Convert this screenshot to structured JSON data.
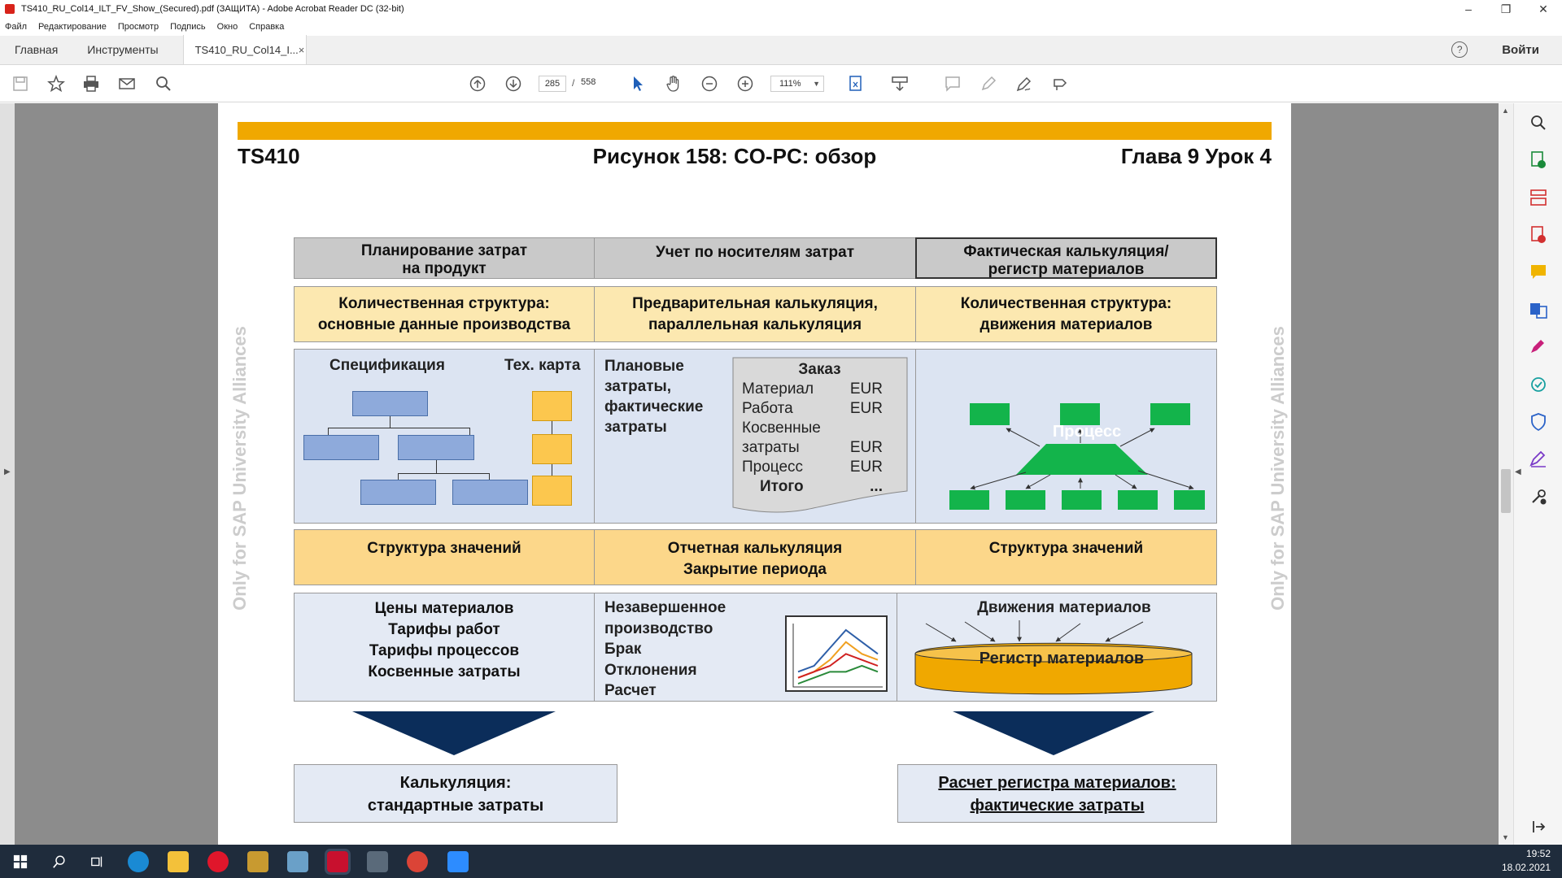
{
  "window": {
    "title": "TS410_RU_Col14_ILT_FV_Show_(Secured).pdf (ЗАЩИТА) - Adobe Acrobat Reader DC (32-bit)",
    "minimize": "–",
    "restore": "❐",
    "close": "✕"
  },
  "menu": [
    "Файл",
    "Редактирование",
    "Просмотр",
    "Подпись",
    "Окно",
    "Справка"
  ],
  "tabs": {
    "home": "Главная",
    "tools": "Инструменты",
    "document": "TS410_RU_Col14_I...",
    "document_close": "×"
  },
  "account": {
    "help": "?",
    "signin": "Войти"
  },
  "toolbar": {
    "page_current": "285",
    "page_sep": "/",
    "page_total": "558",
    "zoom": "111%"
  },
  "slide": {
    "left_header": "TS410",
    "title": "Рисунок 158: CO-PC: обзор",
    "right_header": "Глава 9 Урок 4",
    "watermark": "Only for SAP University Alliances",
    "col_headers": [
      [
        "Планирование затрат",
        "на продукт"
      ],
      [
        "Учет по носителям затрат"
      ],
      [
        "Фактическая калькуляция/",
        "регистр материалов"
      ]
    ],
    "row1": [
      [
        "Количественная структура:",
        "основные данные производства"
      ],
      [
        "Предварительная калькуляция,",
        "параллельная калькуляция"
      ],
      [
        "Количественная структура:",
        "движения материалов"
      ]
    ],
    "bom_label": "Спецификация",
    "routing_label": "Тех. карта",
    "planned_costs": [
      "Плановые",
      "затраты,",
      "фактические",
      "затраты"
    ],
    "order": {
      "title": "Заказ",
      "lines": [
        [
          "Материал",
          "EUR"
        ],
        [
          "Работа",
          "EUR"
        ],
        [
          "Косвенные",
          ""
        ],
        [
          "затраты",
          "EUR"
        ],
        [
          "Процесс",
          "EUR"
        ]
      ],
      "total_label": "Итого",
      "total_value": "..."
    },
    "process_label": "Процесс",
    "row3": [
      [
        "Структура значений"
      ],
      [
        "Отчетная калькуляция",
        "Закрытие периода"
      ],
      [
        "Структура значений"
      ]
    ],
    "row4_left": [
      "Цены материалов",
      "Тарифы работ",
      "Тарифы процессов",
      "Косвенные затраты"
    ],
    "row4_mid": [
      "Незавершенное",
      "производство",
      "Брак",
      "Отклонения",
      "Расчет"
    ],
    "movements_label": "Движения материалов",
    "ledger_label": "Регистр материалов",
    "result_left": [
      "Калькуляция:",
      "стандартные затраты"
    ],
    "result_right": [
      "Расчет регистра материалов:",
      "фактические затраты"
    ]
  },
  "mini_chart": {
    "series": [
      {
        "color": "#2e5fa8",
        "values": [
          2,
          3,
          6,
          9,
          7,
          5
        ]
      },
      {
        "color": "#f0a020",
        "values": [
          1,
          2,
          4,
          7,
          5,
          4
        ]
      },
      {
        "color": "#d02020",
        "values": [
          1,
          2,
          3,
          5,
          4,
          3
        ]
      },
      {
        "color": "#2a8a3a",
        "values": [
          0,
          1,
          2,
          2,
          3,
          2
        ]
      }
    ]
  },
  "clock": {
    "time": "19:52",
    "date": "18.02.2021"
  },
  "colors": {
    "accent_bar": "#f0a800",
    "process_green": "#13b44b",
    "arrow_navy": "#0b2d5a"
  }
}
